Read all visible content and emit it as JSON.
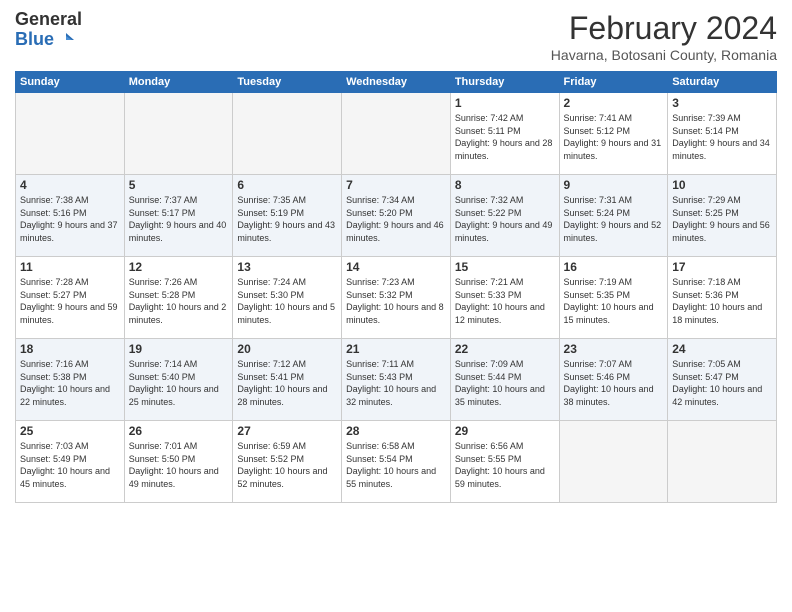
{
  "header": {
    "logo_general": "General",
    "logo_blue": "Blue",
    "month_year": "February 2024",
    "location": "Havarna, Botosani County, Romania"
  },
  "days_of_week": [
    "Sunday",
    "Monday",
    "Tuesday",
    "Wednesday",
    "Thursday",
    "Friday",
    "Saturday"
  ],
  "weeks": [
    [
      {
        "day": "",
        "info": ""
      },
      {
        "day": "",
        "info": ""
      },
      {
        "day": "",
        "info": ""
      },
      {
        "day": "",
        "info": ""
      },
      {
        "day": "1",
        "info": "Sunrise: 7:42 AM\nSunset: 5:11 PM\nDaylight: 9 hours and 28 minutes."
      },
      {
        "day": "2",
        "info": "Sunrise: 7:41 AM\nSunset: 5:12 PM\nDaylight: 9 hours and 31 minutes."
      },
      {
        "day": "3",
        "info": "Sunrise: 7:39 AM\nSunset: 5:14 PM\nDaylight: 9 hours and 34 minutes."
      }
    ],
    [
      {
        "day": "4",
        "info": "Sunrise: 7:38 AM\nSunset: 5:16 PM\nDaylight: 9 hours and 37 minutes."
      },
      {
        "day": "5",
        "info": "Sunrise: 7:37 AM\nSunset: 5:17 PM\nDaylight: 9 hours and 40 minutes."
      },
      {
        "day": "6",
        "info": "Sunrise: 7:35 AM\nSunset: 5:19 PM\nDaylight: 9 hours and 43 minutes."
      },
      {
        "day": "7",
        "info": "Sunrise: 7:34 AM\nSunset: 5:20 PM\nDaylight: 9 hours and 46 minutes."
      },
      {
        "day": "8",
        "info": "Sunrise: 7:32 AM\nSunset: 5:22 PM\nDaylight: 9 hours and 49 minutes."
      },
      {
        "day": "9",
        "info": "Sunrise: 7:31 AM\nSunset: 5:24 PM\nDaylight: 9 hours and 52 minutes."
      },
      {
        "day": "10",
        "info": "Sunrise: 7:29 AM\nSunset: 5:25 PM\nDaylight: 9 hours and 56 minutes."
      }
    ],
    [
      {
        "day": "11",
        "info": "Sunrise: 7:28 AM\nSunset: 5:27 PM\nDaylight: 9 hours and 59 minutes."
      },
      {
        "day": "12",
        "info": "Sunrise: 7:26 AM\nSunset: 5:28 PM\nDaylight: 10 hours and 2 minutes."
      },
      {
        "day": "13",
        "info": "Sunrise: 7:24 AM\nSunset: 5:30 PM\nDaylight: 10 hours and 5 minutes."
      },
      {
        "day": "14",
        "info": "Sunrise: 7:23 AM\nSunset: 5:32 PM\nDaylight: 10 hours and 8 minutes."
      },
      {
        "day": "15",
        "info": "Sunrise: 7:21 AM\nSunset: 5:33 PM\nDaylight: 10 hours and 12 minutes."
      },
      {
        "day": "16",
        "info": "Sunrise: 7:19 AM\nSunset: 5:35 PM\nDaylight: 10 hours and 15 minutes."
      },
      {
        "day": "17",
        "info": "Sunrise: 7:18 AM\nSunset: 5:36 PM\nDaylight: 10 hours and 18 minutes."
      }
    ],
    [
      {
        "day": "18",
        "info": "Sunrise: 7:16 AM\nSunset: 5:38 PM\nDaylight: 10 hours and 22 minutes."
      },
      {
        "day": "19",
        "info": "Sunrise: 7:14 AM\nSunset: 5:40 PM\nDaylight: 10 hours and 25 minutes."
      },
      {
        "day": "20",
        "info": "Sunrise: 7:12 AM\nSunset: 5:41 PM\nDaylight: 10 hours and 28 minutes."
      },
      {
        "day": "21",
        "info": "Sunrise: 7:11 AM\nSunset: 5:43 PM\nDaylight: 10 hours and 32 minutes."
      },
      {
        "day": "22",
        "info": "Sunrise: 7:09 AM\nSunset: 5:44 PM\nDaylight: 10 hours and 35 minutes."
      },
      {
        "day": "23",
        "info": "Sunrise: 7:07 AM\nSunset: 5:46 PM\nDaylight: 10 hours and 38 minutes."
      },
      {
        "day": "24",
        "info": "Sunrise: 7:05 AM\nSunset: 5:47 PM\nDaylight: 10 hours and 42 minutes."
      }
    ],
    [
      {
        "day": "25",
        "info": "Sunrise: 7:03 AM\nSunset: 5:49 PM\nDaylight: 10 hours and 45 minutes."
      },
      {
        "day": "26",
        "info": "Sunrise: 7:01 AM\nSunset: 5:50 PM\nDaylight: 10 hours and 49 minutes."
      },
      {
        "day": "27",
        "info": "Sunrise: 6:59 AM\nSunset: 5:52 PM\nDaylight: 10 hours and 52 minutes."
      },
      {
        "day": "28",
        "info": "Sunrise: 6:58 AM\nSunset: 5:54 PM\nDaylight: 10 hours and 55 minutes."
      },
      {
        "day": "29",
        "info": "Sunrise: 6:56 AM\nSunset: 5:55 PM\nDaylight: 10 hours and 59 minutes."
      },
      {
        "day": "",
        "info": ""
      },
      {
        "day": "",
        "info": ""
      }
    ]
  ]
}
